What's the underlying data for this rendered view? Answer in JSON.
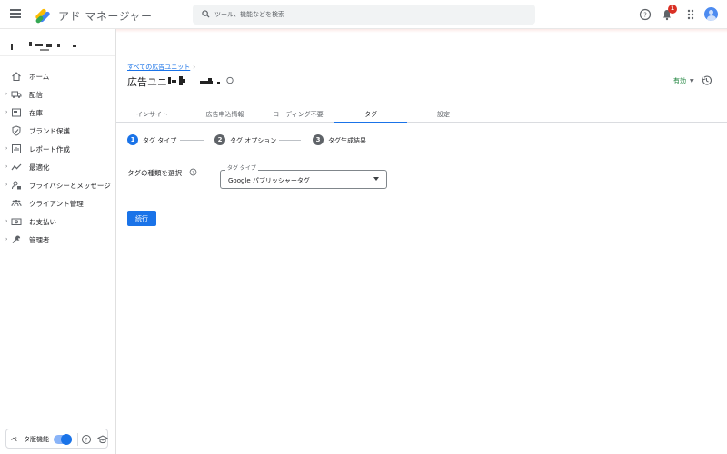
{
  "app": {
    "name": "アド マネージャー",
    "notification_count": "1"
  },
  "search": {
    "placeholder": "ツール、機能などを検索"
  },
  "sidebar": {
    "items": [
      {
        "label": "ホーム",
        "icon": "home-icon",
        "has_caret": false
      },
      {
        "label": "配信",
        "icon": "truck-icon",
        "has_caret": true
      },
      {
        "label": "在庫",
        "icon": "inventory-icon",
        "has_caret": true
      },
      {
        "label": "ブランド保護",
        "icon": "shield-icon",
        "has_caret": false
      },
      {
        "label": "レポート作成",
        "icon": "report-icon",
        "has_caret": true
      },
      {
        "label": "最適化",
        "icon": "trend-icon",
        "has_caret": true
      },
      {
        "label": "プライバシーとメッセージ",
        "icon": "privacy-icon",
        "has_caret": true
      },
      {
        "label": "クライアント管理",
        "icon": "clients-icon",
        "has_caret": false
      },
      {
        "label": "お支払い",
        "icon": "payment-icon",
        "has_caret": true
      },
      {
        "label": "管理者",
        "icon": "wrench-icon",
        "has_caret": true
      }
    ],
    "beta_label": "ベータ版機能",
    "beta_enabled": true
  },
  "main": {
    "breadcrumb": "すべての広告ユニット",
    "title": "広告ユニ",
    "status": "有効",
    "tabs": [
      {
        "label": "インサイト",
        "active": false
      },
      {
        "label": "広告申込情報",
        "active": false
      },
      {
        "label": "コーディング不要",
        "active": false
      },
      {
        "label": "タグ",
        "active": true
      },
      {
        "label": "設定",
        "active": false
      }
    ],
    "steps": [
      {
        "num": "1",
        "label": "タグ タイプ",
        "active": true
      },
      {
        "num": "2",
        "label": "タグ オプション",
        "active": false
      },
      {
        "num": "3",
        "label": "タグ生成結果",
        "active": false
      }
    ],
    "form": {
      "label": "タグの種類を選択",
      "select_label": "タグ タイプ",
      "select_value": "Google パブリッシャータグ"
    },
    "continue_label": "続行"
  },
  "colors": {
    "accent": "#1a73e8",
    "status_green": "#188038",
    "badge_red": "#d93025"
  }
}
